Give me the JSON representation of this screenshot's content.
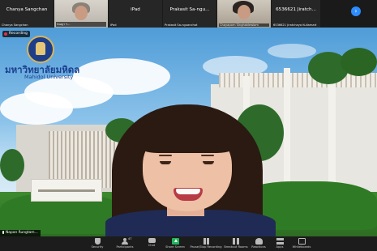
{
  "participants": [
    {
      "display_name": "Chanya Sangchan",
      "caption": "Chanya Sangchan",
      "has_video": false
    },
    {
      "display_name": "",
      "caption": "ชนญา ฯ...",
      "has_video": true
    },
    {
      "display_name": "iPad",
      "caption": "iPad",
      "has_video": false
    },
    {
      "display_name": "Prakasit Sa-ngu...",
      "caption": "Prakasit Sa-nguanchat",
      "has_video": false
    },
    {
      "display_name": "",
      "caption": "Chayaporn Singhaklewiam",
      "has_video": true
    },
    {
      "display_name": "6536621 Jiratch...",
      "caption": "6536621 Jiratchaya Kullamart",
      "has_video": false
    }
  ],
  "recording_label": "Recording",
  "speaker_name": "Napan Rungtam...",
  "logo": {
    "title": "มหาวิทยาลัยมหิดล",
    "subtitle": "Mahidol University"
  },
  "toolbar": {
    "items": [
      {
        "label": "Security",
        "icon": "shield-icon"
      },
      {
        "label": "Participants",
        "icon": "participants-icon",
        "count": "47"
      },
      {
        "label": "Chat",
        "icon": "chat-icon"
      },
      {
        "label": "Share Screen",
        "icon": "share-screen-icon"
      },
      {
        "label": "Pause/Stop Recording",
        "icon": "pause-icon"
      },
      {
        "label": "Breakout Rooms",
        "icon": "breakout-rooms-icon"
      },
      {
        "label": "Reactions",
        "icon": "reactions-icon"
      },
      {
        "label": "Apps",
        "icon": "apps-icon"
      },
      {
        "label": "Whiteboards",
        "icon": "whiteboard-icon"
      }
    ]
  },
  "colors": {
    "accent": "#2d8cff",
    "share": "#22b45a",
    "record": "#e8303a"
  }
}
